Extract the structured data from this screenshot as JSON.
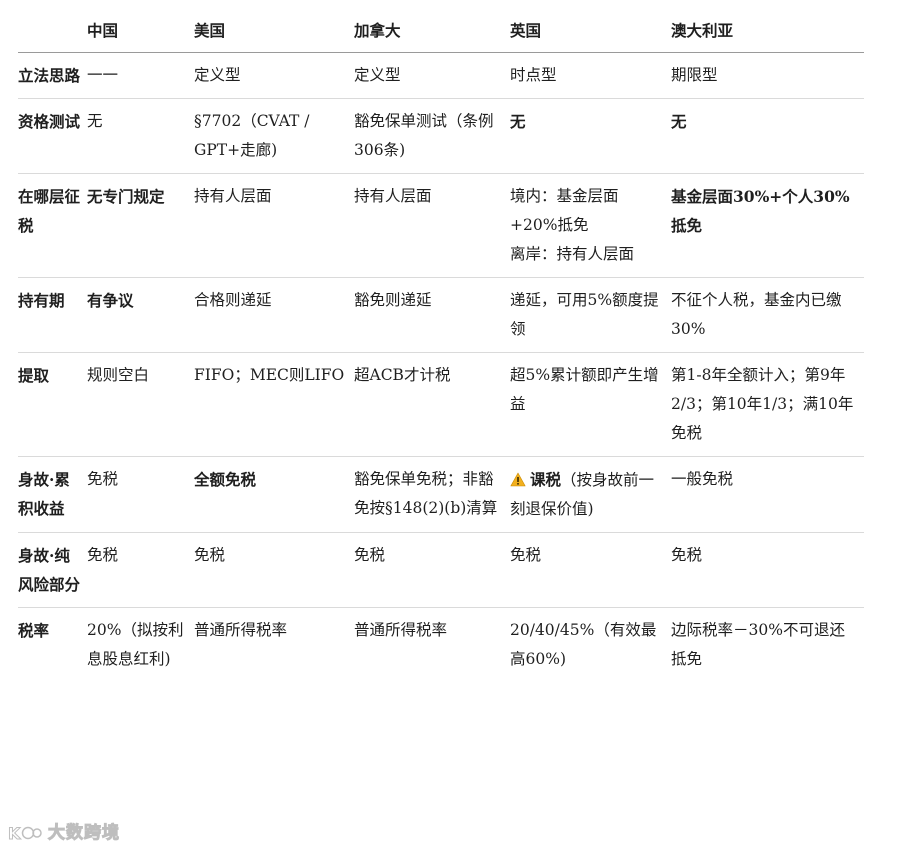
{
  "table": {
    "headers": [
      "",
      "中国",
      "美国",
      "加拿大",
      "英国",
      "澳大利亚"
    ],
    "rows": [
      {
        "label": "立法思路",
        "cells": [
          {
            "text": "一一"
          },
          {
            "text": "定义型"
          },
          {
            "text": "定义型"
          },
          {
            "text": "时点型"
          },
          {
            "text": "期限型"
          }
        ]
      },
      {
        "label": "资格测试",
        "cells": [
          {
            "text": "无"
          },
          {
            "text": "§7702（CVAT / GPT+走廊)"
          },
          {
            "text": "豁免保单测试（条例306条)"
          },
          {
            "text": "无",
            "bold": true
          },
          {
            "text": "无",
            "bold": true
          }
        ]
      },
      {
        "label": "在哪层征税",
        "cells": [
          {
            "text": "无专门规定",
            "bold": true
          },
          {
            "text": "持有人层面"
          },
          {
            "text": "持有人层面"
          },
          {
            "text": "境内：基金层面+20%抵免\n离岸：持有人层面"
          },
          {
            "text": "基金层面30%+个人30%抵免",
            "bold": true
          }
        ]
      },
      {
        "label": "持有期",
        "cells": [
          {
            "text": "有争议",
            "bold": true
          },
          {
            "text": "合格则递延"
          },
          {
            "text": "豁免则递延"
          },
          {
            "text": "递延，可用5%额度提领"
          },
          {
            "text": "不征个人税，基金内已缴30%"
          }
        ]
      },
      {
        "label": "提取",
        "cells": [
          {
            "text": "规则空白"
          },
          {
            "text": "FIFO；MEC则LIFO"
          },
          {
            "text": "超ACB才计税"
          },
          {
            "text": "超5%累计额即产生增益"
          },
          {
            "text": "第1-8年全额计入；第9年2/3；第10年1/3；满10年免税"
          }
        ]
      },
      {
        "label": "身故·累积收益",
        "cells": [
          {
            "text": "免税"
          },
          {
            "text": "全额免税",
            "bold": true
          },
          {
            "text": "豁免保单免税；非豁免按§148(2)(b)清算"
          },
          {
            "lead": "课税",
            "text": "（按身故前一刻退保价值)",
            "warn": true
          },
          {
            "text": "一般免税"
          }
        ]
      },
      {
        "label": "身故·纯风险部分",
        "cells": [
          {
            "text": "免税"
          },
          {
            "text": "免税"
          },
          {
            "text": "免税"
          },
          {
            "text": "免税"
          },
          {
            "text": "免税"
          }
        ]
      },
      {
        "label": "税率",
        "cells": [
          {
            "text": "20%（拟按利息股息红利)"
          },
          {
            "text": "普通所得税率"
          },
          {
            "text": "普通所得税率"
          },
          {
            "text": "20/40/45%（有效最高60%)"
          },
          {
            "text": "边际税率－30%不可退还抵免"
          }
        ]
      }
    ]
  },
  "watermark": {
    "text": "大数跨境",
    "icon": "kcc-logo-icon"
  },
  "colors": {
    "text": "#1f1f1f",
    "header_rule": "#9a9a9a",
    "row_rule": "#dadada",
    "warn": "#f2b01e"
  }
}
